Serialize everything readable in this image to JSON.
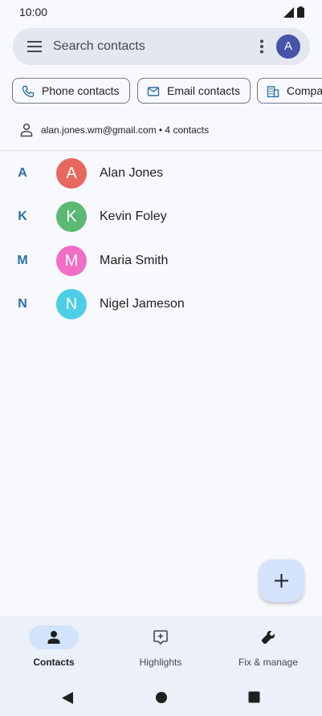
{
  "status_bar": {
    "time": "10:00"
  },
  "search": {
    "placeholder": "Search contacts",
    "avatar_letter": "A"
  },
  "chips": [
    {
      "label": "Phone contacts",
      "icon": "phone-icon"
    },
    {
      "label": "Email contacts",
      "icon": "email-icon"
    },
    {
      "label": "Compar",
      "icon": "building-icon"
    }
  ],
  "account": {
    "text": "alan.jones.wm@gmail.com • 4 contacts"
  },
  "contacts": [
    {
      "section_letter": "A",
      "avatar_letter": "A",
      "name": "Alan Jones",
      "color": "#e8685f"
    },
    {
      "section_letter": "K",
      "avatar_letter": "K",
      "name": "Kevin Foley",
      "color": "#5bb974"
    },
    {
      "section_letter": "M",
      "avatar_letter": "M",
      "name": "Maria Smith",
      "color": "#f06ec5"
    },
    {
      "section_letter": "N",
      "avatar_letter": "N",
      "name": "Nigel Jameson",
      "color": "#4ecde6"
    }
  ],
  "bottom_nav": [
    {
      "label": "Contacts",
      "icon": "person-icon",
      "active": true
    },
    {
      "label": "Highlights",
      "icon": "sparkle-icon",
      "active": false
    },
    {
      "label": "Fix & manage",
      "icon": "wrench-icon",
      "active": false
    }
  ],
  "colors": {
    "accent": "#2e6ea5",
    "search_bar": "#e3e7f0",
    "fab": "#d6e3ff",
    "nav_active": "#d3e3fd"
  }
}
